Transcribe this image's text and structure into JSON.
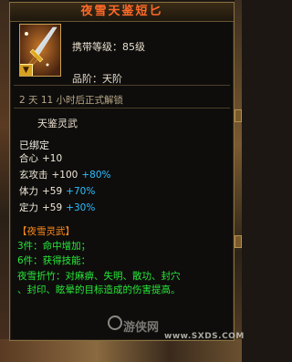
{
  "tooltip": {
    "title": "夜雪天鉴短匕",
    "requirement": "携带等级：85级",
    "grade": "品阶：天阶",
    "unlock_notice": "2 天 11 小时后正式解锁",
    "category": "天鉴灵武",
    "bound_status": "已绑定",
    "attributes": [
      {
        "name": "合心",
        "value": "+10",
        "bonus": ""
      },
      {
        "name": "玄攻击",
        "value": "+100",
        "bonus": "+80%"
      },
      {
        "name": "体力",
        "value": "+59",
        "bonus": "+70%"
      },
      {
        "name": "定力",
        "value": "+59",
        "bonus": "+30%"
      }
    ],
    "set": {
      "name": "【夜雪灵武】",
      "piece3": "3件：命中增加；",
      "piece6": "6件：获得技能：",
      "desc_line1": "夜雪折竹：对麻痹、失明、散功、封穴",
      "desc_line2": "、封印、眩晕的目标造成的伤害提高。"
    }
  },
  "watermark": {
    "text": "游侠网",
    "url": "www.SXDS.COM"
  },
  "icon": {
    "name": "dagger-icon",
    "badge": "equipped-badge-icon"
  },
  "colors": {
    "title": "#ff6a28",
    "bonus": "#2fbfff",
    "set_name": "#ff8a1a",
    "set_text": "#28e838"
  }
}
